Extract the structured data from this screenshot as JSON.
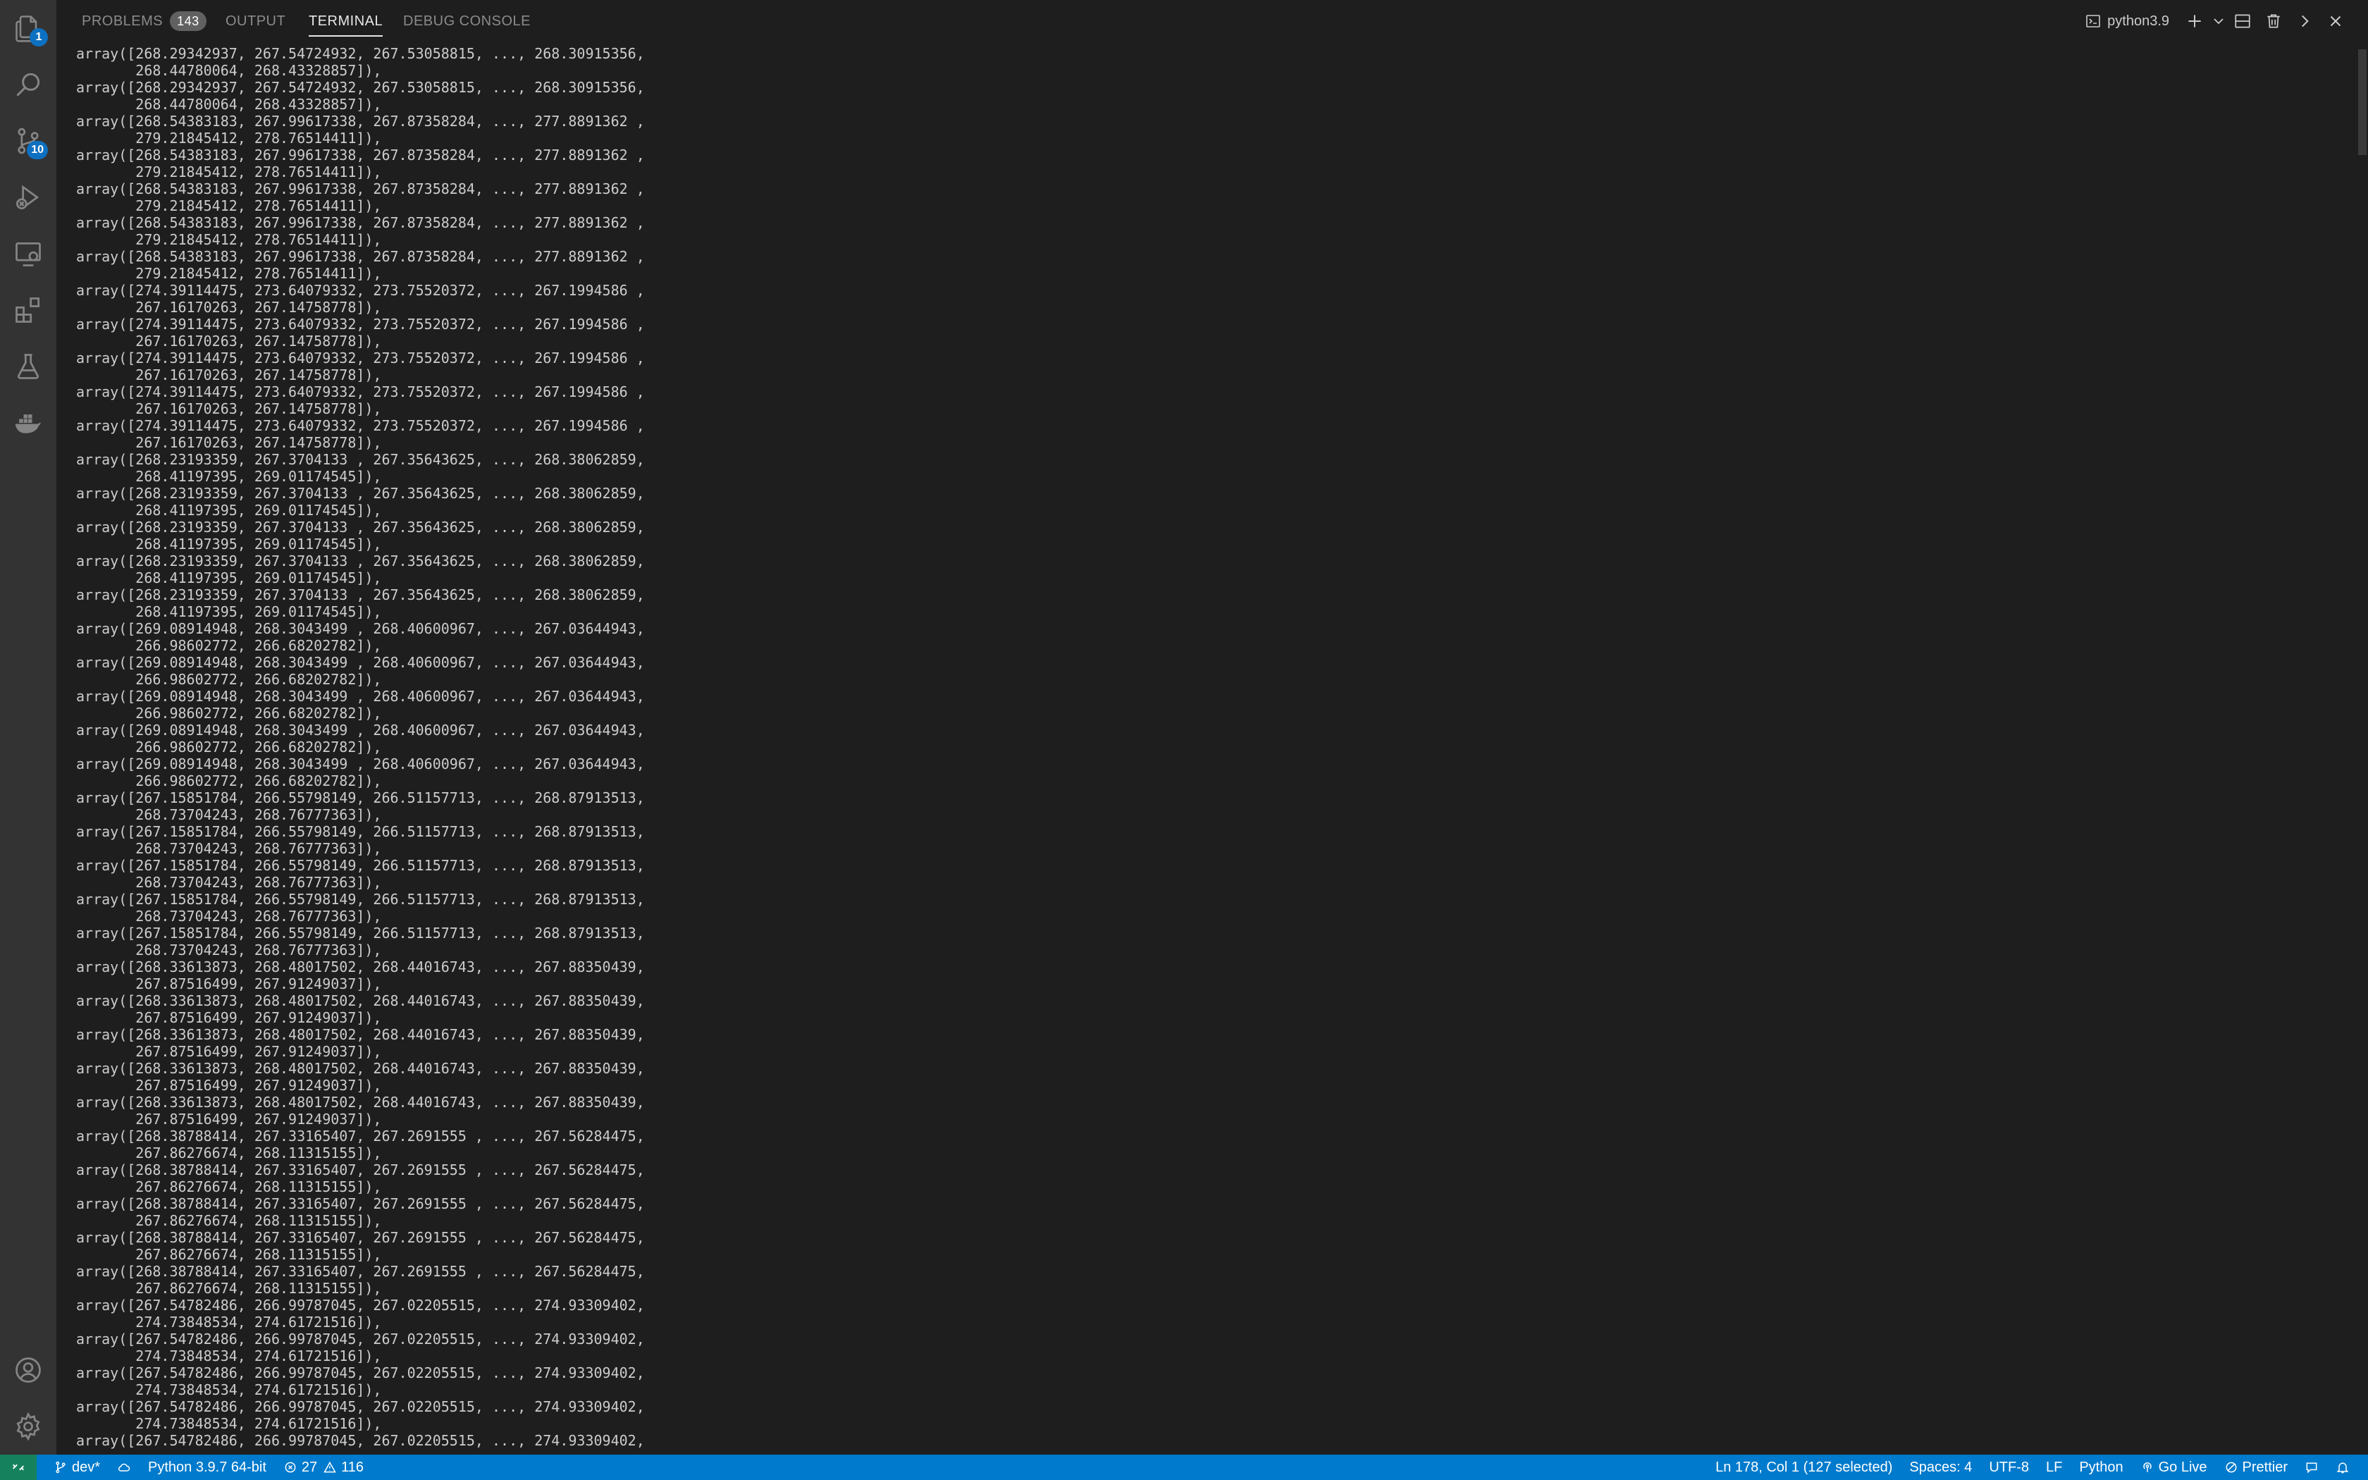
{
  "activity_bar": {
    "explorer_badge": "1",
    "scm_badge": "10"
  },
  "panel": {
    "tabs": [
      {
        "label": "PROBLEMS",
        "count": "143"
      },
      {
        "label": "OUTPUT"
      },
      {
        "label": "TERMINAL"
      },
      {
        "label": "DEBUG CONSOLE"
      }
    ],
    "terminal_name": "python3.9"
  },
  "terminal_lines": [
    "array([268.29342937, 267.54724932, 267.53058815, ..., 268.30915356,",
    "       268.44780064, 268.43328857]),",
    "array([268.29342937, 267.54724932, 267.53058815, ..., 268.30915356,",
    "       268.44780064, 268.43328857]),",
    "array([268.54383183, 267.99617338, 267.87358284, ..., 277.8891362 ,",
    "       279.21845412, 278.76514411]),",
    "array([268.54383183, 267.99617338, 267.87358284, ..., 277.8891362 ,",
    "       279.21845412, 278.76514411]),",
    "array([268.54383183, 267.99617338, 267.87358284, ..., 277.8891362 ,",
    "       279.21845412, 278.76514411]),",
    "array([268.54383183, 267.99617338, 267.87358284, ..., 277.8891362 ,",
    "       279.21845412, 278.76514411]),",
    "array([268.54383183, 267.99617338, 267.87358284, ..., 277.8891362 ,",
    "       279.21845412, 278.76514411]),",
    "array([274.39114475, 273.64079332, 273.75520372, ..., 267.1994586 ,",
    "       267.16170263, 267.14758778]),",
    "array([274.39114475, 273.64079332, 273.75520372, ..., 267.1994586 ,",
    "       267.16170263, 267.14758778]),",
    "array([274.39114475, 273.64079332, 273.75520372, ..., 267.1994586 ,",
    "       267.16170263, 267.14758778]),",
    "array([274.39114475, 273.64079332, 273.75520372, ..., 267.1994586 ,",
    "       267.16170263, 267.14758778]),",
    "array([274.39114475, 273.64079332, 273.75520372, ..., 267.1994586 ,",
    "       267.16170263, 267.14758778]),",
    "array([268.23193359, 267.3704133 , 267.35643625, ..., 268.38062859,",
    "       268.41197395, 269.01174545]),",
    "array([268.23193359, 267.3704133 , 267.35643625, ..., 268.38062859,",
    "       268.41197395, 269.01174545]),",
    "array([268.23193359, 267.3704133 , 267.35643625, ..., 268.38062859,",
    "       268.41197395, 269.01174545]),",
    "array([268.23193359, 267.3704133 , 267.35643625, ..., 268.38062859,",
    "       268.41197395, 269.01174545]),",
    "array([268.23193359, 267.3704133 , 267.35643625, ..., 268.38062859,",
    "       268.41197395, 269.01174545]),",
    "array([269.08914948, 268.3043499 , 268.40600967, ..., 267.03644943,",
    "       266.98602772, 266.68202782]),",
    "array([269.08914948, 268.3043499 , 268.40600967, ..., 267.03644943,",
    "       266.98602772, 266.68202782]),",
    "array([269.08914948, 268.3043499 , 268.40600967, ..., 267.03644943,",
    "       266.98602772, 266.68202782]),",
    "array([269.08914948, 268.3043499 , 268.40600967, ..., 267.03644943,",
    "       266.98602772, 266.68202782]),",
    "array([269.08914948, 268.3043499 , 268.40600967, ..., 267.03644943,",
    "       266.98602772, 266.68202782]),",
    "array([267.15851784, 266.55798149, 266.51157713, ..., 268.87913513,",
    "       268.73704243, 268.76777363]),",
    "array([267.15851784, 266.55798149, 266.51157713, ..., 268.87913513,",
    "       268.73704243, 268.76777363]),",
    "array([267.15851784, 266.55798149, 266.51157713, ..., 268.87913513,",
    "       268.73704243, 268.76777363]),",
    "array([267.15851784, 266.55798149, 266.51157713, ..., 268.87913513,",
    "       268.73704243, 268.76777363]),",
    "array([267.15851784, 266.55798149, 266.51157713, ..., 268.87913513,",
    "       268.73704243, 268.76777363]),",
    "array([268.33613873, 268.48017502, 268.44016743, ..., 267.88350439,",
    "       267.87516499, 267.91249037]),",
    "array([268.33613873, 268.48017502, 268.44016743, ..., 267.88350439,",
    "       267.87516499, 267.91249037]),",
    "array([268.33613873, 268.48017502, 268.44016743, ..., 267.88350439,",
    "       267.87516499, 267.91249037]),",
    "array([268.33613873, 268.48017502, 268.44016743, ..., 267.88350439,",
    "       267.87516499, 267.91249037]),",
    "array([268.33613873, 268.48017502, 268.44016743, ..., 267.88350439,",
    "       267.87516499, 267.91249037]),",
    "array([268.38788414, 267.33165407, 267.2691555 , ..., 267.56284475,",
    "       267.86276674, 268.11315155]),",
    "array([268.38788414, 267.33165407, 267.2691555 , ..., 267.56284475,",
    "       267.86276674, 268.11315155]),",
    "array([268.38788414, 267.33165407, 267.2691555 , ..., 267.56284475,",
    "       267.86276674, 268.11315155]),",
    "array([268.38788414, 267.33165407, 267.2691555 , ..., 267.56284475,",
    "       267.86276674, 268.11315155]),",
    "array([268.38788414, 267.33165407, 267.2691555 , ..., 267.56284475,",
    "       267.86276674, 268.11315155]),",
    "array([267.54782486, 266.99787045, 267.02205515, ..., 274.93309402,",
    "       274.73848534, 274.61721516]),",
    "array([267.54782486, 266.99787045, 267.02205515, ..., 274.93309402,",
    "       274.73848534, 274.61721516]),",
    "array([267.54782486, 266.99787045, 267.02205515, ..., 274.93309402,",
    "       274.73848534, 274.61721516]),",
    "array([267.54782486, 266.99787045, 267.02205515, ..., 274.93309402,",
    "       274.73848534, 274.61721516]),",
    "array([267.54782486, 266.99787045, 267.02205515, ..., 274.93309402,"
  ],
  "status_bar": {
    "branch": "dev*",
    "interpreter": "Python 3.9.7 64-bit",
    "errors": "27",
    "warnings": "116",
    "cursor": "Ln 178, Col 1 (127 selected)",
    "spaces": "Spaces: 4",
    "encoding": "UTF-8",
    "eol": "LF",
    "language": "Python",
    "go_live": "Go Live",
    "prettier": "Prettier"
  }
}
